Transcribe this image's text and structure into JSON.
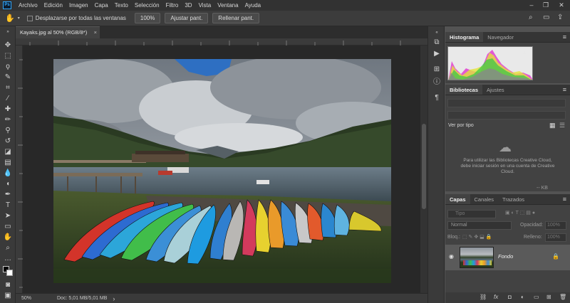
{
  "menu": {
    "items": [
      "Archivo",
      "Edición",
      "Imagen",
      "Capa",
      "Texto",
      "Selección",
      "Filtro",
      "3D",
      "Vista",
      "Ventana",
      "Ayuda"
    ],
    "window_controls": [
      "–",
      "❐",
      "✕"
    ]
  },
  "options": {
    "scroll_all_label": "Desplazarse por todas las ventanas",
    "zoom_100": "100%",
    "fit_screen": "Ajustar pant.",
    "fill_screen": "Rellenar pant."
  },
  "document": {
    "tab_title": "Kayaks.jpg al 50% (RGB/8*)",
    "tab_close": "×"
  },
  "status": {
    "zoom": "50%",
    "doc_info": "Doc: 5,01 MB/5,01 MB",
    "arrow": "›"
  },
  "histogram": {
    "tabs": [
      "Histograma",
      "Navegador"
    ],
    "warning": "▲"
  },
  "libraries": {
    "tabs": [
      "Bibliotecas",
      "Ajustes"
    ],
    "view_by": "Ver por tipo",
    "message": "Para utilizar las Bibliotecas Creative Cloud, debe iniciar sesión en una cuenta de Creative Cloud.",
    "size_label": "-- KB"
  },
  "layers": {
    "tabs": [
      "Capas",
      "Canales",
      "Trazados"
    ],
    "filter_placeholder": "Tipo",
    "blend_mode": "Normal",
    "opacity_label": "Opacidad:",
    "opacity_value": "100%",
    "lock_label": "Bloq.:",
    "fill_label": "Relleno:",
    "fill_value": "100%",
    "layer_name": "Fondo"
  },
  "colors": {
    "accent": "#31a8ff",
    "panel_bg": "#424242",
    "canvas_bg": "#282828"
  }
}
